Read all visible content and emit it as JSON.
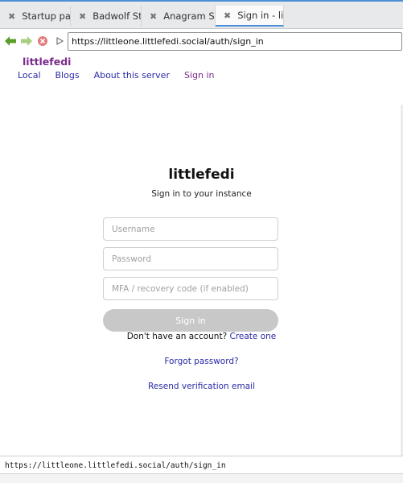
{
  "tabs": [
    {
      "label": "Startup page",
      "active": false
    },
    {
      "label": "Badwolf St...",
      "active": false
    },
    {
      "label": "Anagram S...",
      "active": false
    },
    {
      "label": "Sign in - litt...",
      "active": true
    }
  ],
  "toolbar": {
    "url": "https://littleone.littlefedi.social/auth/sign_in"
  },
  "site": {
    "brand": "littlefedi",
    "nav": [
      "Local",
      "Blogs",
      "About this server",
      "Sign in"
    ]
  },
  "signin": {
    "title": "littlefedi",
    "subtitle": "Sign in to your instance",
    "username_placeholder": "Username",
    "password_placeholder": "Password",
    "mfa_placeholder": "MFA / recovery code (if enabled)",
    "button_label": "Sign in",
    "register_prompt": "Don't have an account?",
    "register_link": "Create one",
    "forgot_link": "Forgot password?",
    "resend_link": "Resend verification email"
  },
  "status": {
    "text": "https://littleone.littlefedi.social/auth/sign_in"
  },
  "colors": {
    "brand": "#7a2a8a",
    "link": "#2a2aa8",
    "button_disabled": "#c8c8c8",
    "tab_accent": "#4a90d9"
  }
}
